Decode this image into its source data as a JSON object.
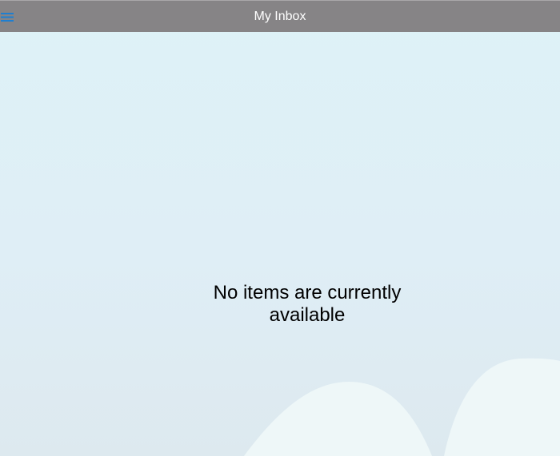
{
  "header": {
    "title": "My Inbox",
    "menu_icon": "hamburger-menu-icon"
  },
  "inbox": {
    "empty_message_line1": "No items are currently",
    "empty_message_line2": "available"
  },
  "colors": {
    "header_bg": "#868486",
    "header_text": "#ffffff",
    "menu_icon": "#1f7fd0",
    "page_bg": "#def2f7",
    "decoration": "#eef7f8"
  }
}
